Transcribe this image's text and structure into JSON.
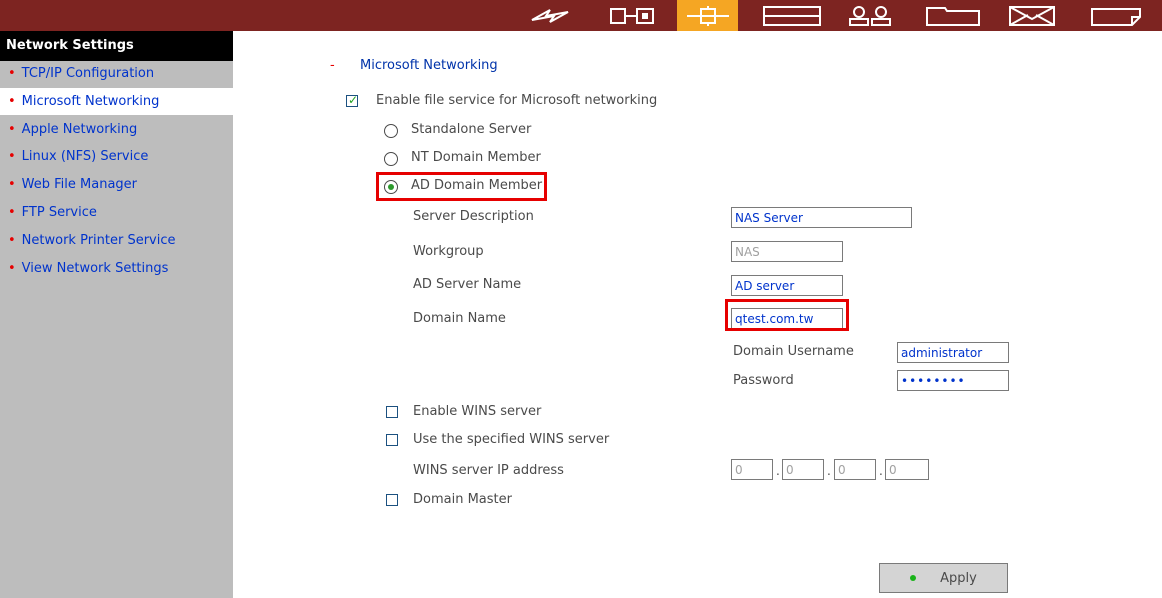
{
  "topbar": {
    "icons": [
      "wizard-icon",
      "system-icon",
      "network-icon",
      "device-icon",
      "users-icon",
      "share-icon",
      "mail-icon",
      "status-icon"
    ]
  },
  "sidebar": {
    "title": "Network Settings",
    "items": [
      {
        "label": "TCP/IP Configuration"
      },
      {
        "label": "Microsoft Networking"
      },
      {
        "label": "Apple Networking"
      },
      {
        "label": "Linux (NFS) Service"
      },
      {
        "label": "Web File Manager"
      },
      {
        "label": "FTP Service"
      },
      {
        "label": "Network Printer Service"
      },
      {
        "label": "View Network Settings"
      }
    ]
  },
  "main": {
    "section_dash": "-",
    "section_title": "Microsoft Networking",
    "enable_label": "Enable file service for Microsoft networking",
    "radio_standalone": "Standalone Server",
    "radio_nt": "NT Domain Member",
    "radio_ad": "AD Domain Member",
    "server_desc_label": "Server Description",
    "server_desc_value": "NAS Server",
    "workgroup_label": "Workgroup",
    "workgroup_value": "NAS",
    "ad_server_label": "AD Server Name",
    "ad_server_value": "AD server",
    "domain_name_label": "Domain Name",
    "domain_name_value": "qtest.com.tw",
    "domain_user_label": "Domain Username",
    "domain_user_value": "administrator",
    "password_label": "Password",
    "password_value": "••••••••",
    "wins_enable_label": "Enable WINS server",
    "wins_specified_label": "Use the specified WINS server",
    "wins_ip_label": "WINS server IP address",
    "wins_ip": [
      "0",
      "0",
      "0",
      "0"
    ],
    "ip_sep": ".",
    "domain_master_label": "Domain Master",
    "apply_label": "Apply"
  }
}
